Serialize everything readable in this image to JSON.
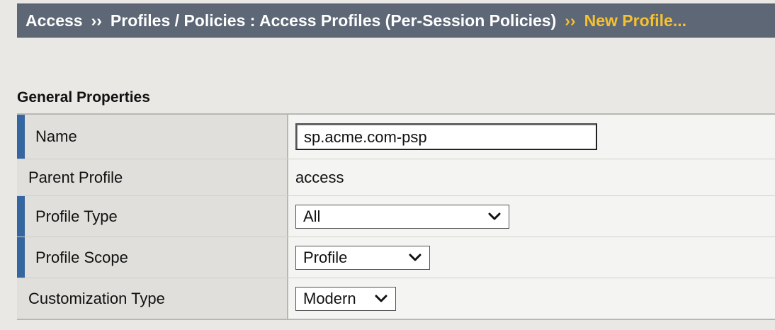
{
  "breadcrumb": {
    "items": [
      "Access",
      "Profiles / Policies : Access Profiles (Per-Session Policies)"
    ],
    "separator": "››",
    "current": "New Profile..."
  },
  "section": {
    "title": "General Properties"
  },
  "fields": {
    "name": {
      "label": "Name",
      "value": "sp.acme.com-psp",
      "required": true
    },
    "parent_profile": {
      "label": "Parent Profile",
      "value": "access",
      "required": false
    },
    "profile_type": {
      "label": "Profile Type",
      "value": "All",
      "required": true
    },
    "profile_scope": {
      "label": "Profile Scope",
      "value": "Profile",
      "required": true
    },
    "customization_type": {
      "label": "Customization Type",
      "value": "Modern",
      "required": false
    }
  },
  "colors": {
    "banner_bg": "#5d6776",
    "current_crumb": "#f6c12f",
    "required_marker": "#3566a0",
    "page_bg": "#e9e8e4"
  },
  "icons": {
    "select_arrow": "chevron-down-icon"
  }
}
